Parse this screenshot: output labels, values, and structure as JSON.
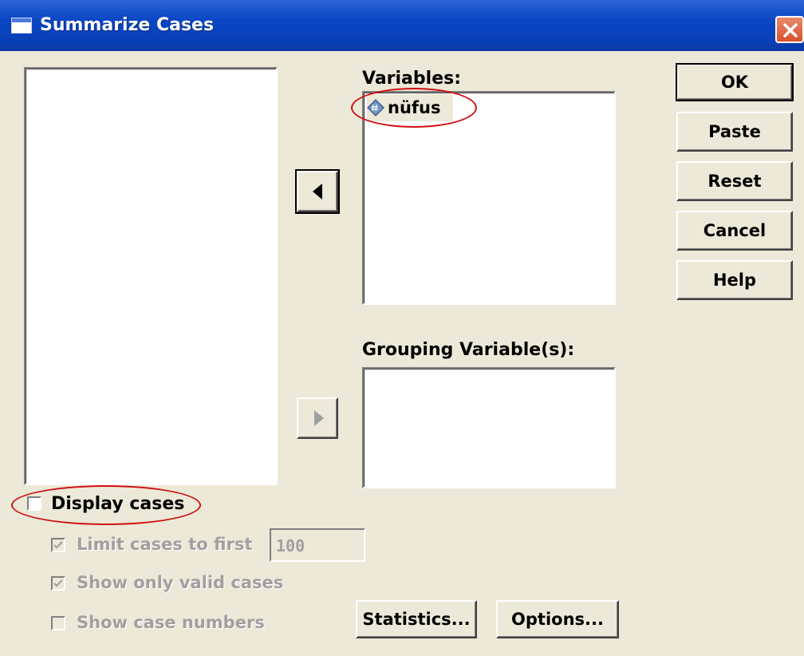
{
  "window": {
    "title": "Summarize Cases"
  },
  "variables": {
    "label": "Variables:",
    "items": [
      "nüfus"
    ]
  },
  "grouping": {
    "label": "Grouping Variable(s):"
  },
  "buttons": {
    "ok": "OK",
    "paste": "Paste",
    "reset": "Reset",
    "cancel": "Cancel",
    "help": "Help",
    "statistics": "Statistics...",
    "options": "Options..."
  },
  "options_area": {
    "display_cases": {
      "label": "Display cases",
      "checked": false
    },
    "limit_cases": {
      "label": "Limit cases to first",
      "checked": true,
      "value": "100"
    },
    "valid_only": {
      "label": "Show only valid cases",
      "checked": true
    },
    "case_numbers": {
      "label": "Show case numbers",
      "checked": false
    }
  },
  "colors": {
    "titlebar": "#0a46c4",
    "dialog_bg": "#ece9d8",
    "highlight_ellipse": "#d01010"
  }
}
